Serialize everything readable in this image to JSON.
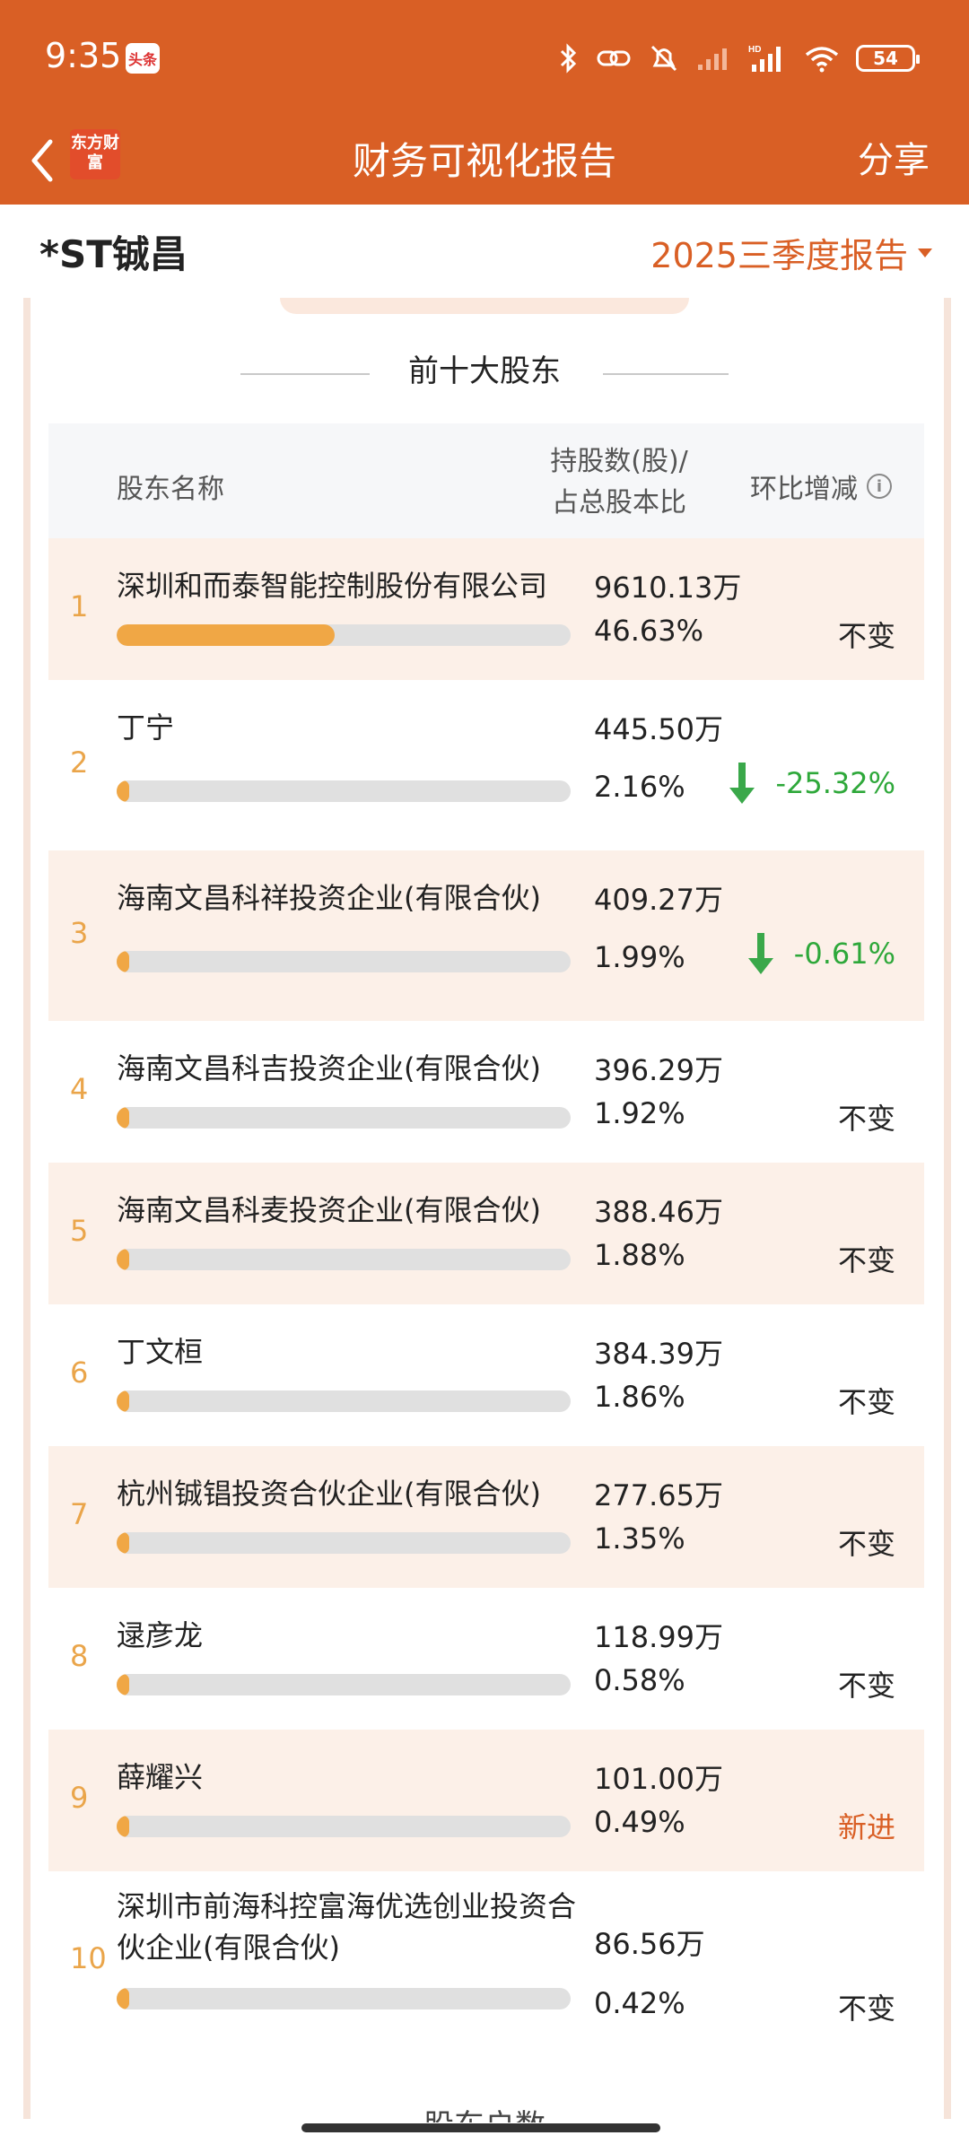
{
  "status_bar": {
    "time": "9:35",
    "news_badge": "头条",
    "battery": "54"
  },
  "header": {
    "logo_text": "东方财富",
    "title": "财务可视化报告",
    "share_label": "分享"
  },
  "stock": {
    "name": "*ST铖昌",
    "period": "2025三季度报告"
  },
  "section": {
    "title": "前十大股东",
    "next_title": "股东户数"
  },
  "table": {
    "col_name": "股东名称",
    "col_hold_line1": "持股数(股)/",
    "col_hold_line2": "占总股本比",
    "col_change": "环比增减",
    "rows": [
      {
        "rank": "1",
        "name": "深圳和而泰智能控制股份有限公司",
        "shares": "9610.13万",
        "pct": "46.63%",
        "ratio": 0.4663,
        "change": "不变",
        "change_type": "same"
      },
      {
        "rank": "2",
        "name": "丁宁",
        "shares": "445.50万",
        "pct": "2.16%",
        "ratio": 0.0216,
        "change": "-25.32%",
        "change_type": "down"
      },
      {
        "rank": "3",
        "name": "海南文昌科祥投资企业(有限合伙)",
        "shares": "409.27万",
        "pct": "1.99%",
        "ratio": 0.0199,
        "change": "-0.61%",
        "change_type": "down"
      },
      {
        "rank": "4",
        "name": "海南文昌科吉投资企业(有限合伙)",
        "shares": "396.29万",
        "pct": "1.92%",
        "ratio": 0.0192,
        "change": "不变",
        "change_type": "same"
      },
      {
        "rank": "5",
        "name": "海南文昌科麦投资企业(有限合伙)",
        "shares": "388.46万",
        "pct": "1.88%",
        "ratio": 0.0188,
        "change": "不变",
        "change_type": "same"
      },
      {
        "rank": "6",
        "name": "丁文桓",
        "shares": "384.39万",
        "pct": "1.86%",
        "ratio": 0.0186,
        "change": "不变",
        "change_type": "same"
      },
      {
        "rank": "7",
        "name": "杭州铖锠投资合伙企业(有限合伙)",
        "shares": "277.65万",
        "pct": "1.35%",
        "ratio": 0.0135,
        "change": "不变",
        "change_type": "same"
      },
      {
        "rank": "8",
        "name": "逯彦龙",
        "shares": "118.99万",
        "pct": "0.58%",
        "ratio": 0.0058,
        "change": "不变",
        "change_type": "same"
      },
      {
        "rank": "9",
        "name": "薛耀兴",
        "shares": "101.00万",
        "pct": "0.49%",
        "ratio": 0.0049,
        "change": "新进",
        "change_type": "new"
      },
      {
        "rank": "10",
        "name": "深圳市前海科控富海优选创业投资合伙企业(有限合伙)",
        "shares": "86.56万",
        "pct": "0.42%",
        "ratio": 0.0042,
        "change": "不变",
        "change_type": "same"
      }
    ]
  },
  "colors": {
    "brand": "#d95f25",
    "bar_fill": "#f0a745",
    "down": "#2ea83a",
    "row_alt": "#fcf0e8"
  }
}
